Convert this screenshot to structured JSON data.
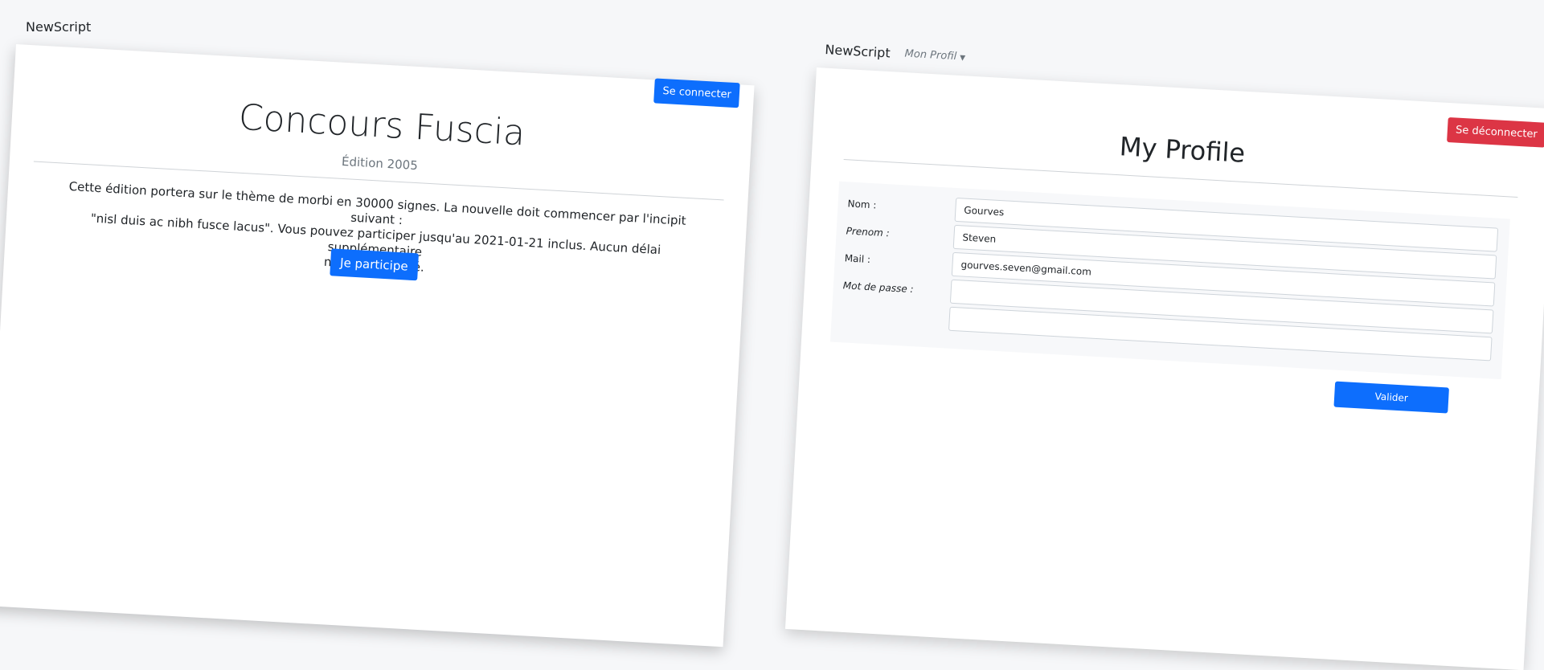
{
  "left_page": {
    "brand": "NewScript",
    "login_button": "Se connecter",
    "title": "Concours Fuscia",
    "edition": "Édition 2005",
    "description_line1": "Cette édition portera sur le thème de morbi en 30000 signes. La nouvelle doit commencer par l'incipit suivant :",
    "description_line2": "\"nisl duis ac nibh fusce lacus\". Vous pouvez participer jusqu'au 2021-01-21 inclus. Aucun délai supplémentaire",
    "description_line3": "ne sera accordé.",
    "participate_button": "Je participe"
  },
  "right_page": {
    "brand": "NewScript",
    "nav_profile": "Mon Profil",
    "logout_button": "Se déconnecter",
    "title": "My Profile",
    "form": {
      "name_label": "Nom :",
      "name_value": "Gourves",
      "firstname_label": "Prenom :",
      "firstname_value": "Steven",
      "mail_label": "Mail :",
      "mail_value": "gourves.seven@gmail.com",
      "password_label": "Mot de passe :",
      "password_value": "",
      "password_confirm_value": "",
      "submit_button": "Valider"
    }
  },
  "colors": {
    "primary": "#0d6efd",
    "danger": "#dc3545",
    "background": "#f6f7f9"
  }
}
